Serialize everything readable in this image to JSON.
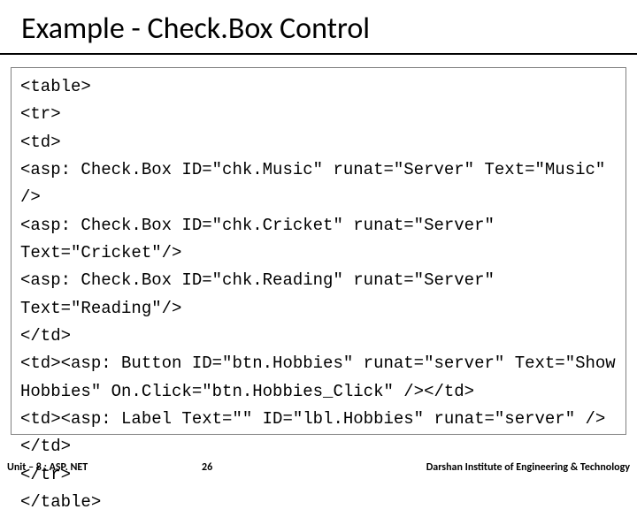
{
  "title": "Example - Check.Box Control",
  "code_lines": [
    "<table>",
    "<tr>",
    "<td>",
    "<asp: Check.Box ID=\"chk.Music\" runat=\"Server\" Text=\"Music\" />",
    "<asp: Check.Box ID=\"chk.Cricket\" runat=\"Server\" Text=\"Cricket\"/>",
    "<asp: Check.Box ID=\"chk.Reading\" runat=\"Server\" Text=\"Reading\"/>",
    "</td>",
    "<td><asp: Button ID=\"btn.Hobbies\" runat=\"server\" Text=\"Show Hobbies\" On.Click=\"btn.Hobbies_Click\" /></td>",
    "<td><asp: Label Text=\"\" ID=\"lbl.Hobbies\" runat=\"server\" /></td>",
    "</tr>",
    "</table>"
  ],
  "footer": {
    "left": "Unit – 8 : ASP. NET",
    "center": "26",
    "right": "Darshan Institute of Engineering & Technology"
  }
}
